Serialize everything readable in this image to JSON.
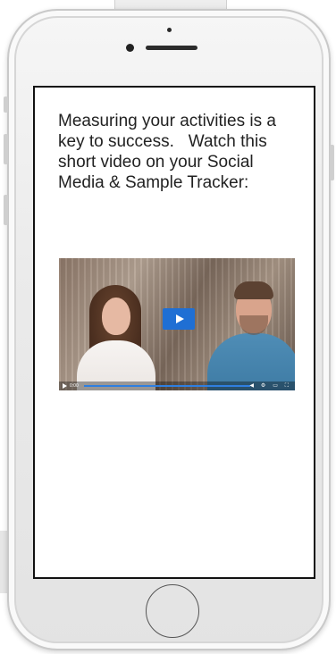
{
  "screen": {
    "message": "Measuring your activities is a key to success.   Watch this short video on your Social Media & Sample Tracker:"
  },
  "video": {
    "play_icon": "play-icon",
    "controls": {
      "time": "0:00",
      "icons": [
        "volume-icon",
        "settings-icon",
        "fullscreen-icon"
      ]
    },
    "accent_color": "#1f6fd4"
  },
  "device": {
    "home_button_icon": "home-button"
  }
}
